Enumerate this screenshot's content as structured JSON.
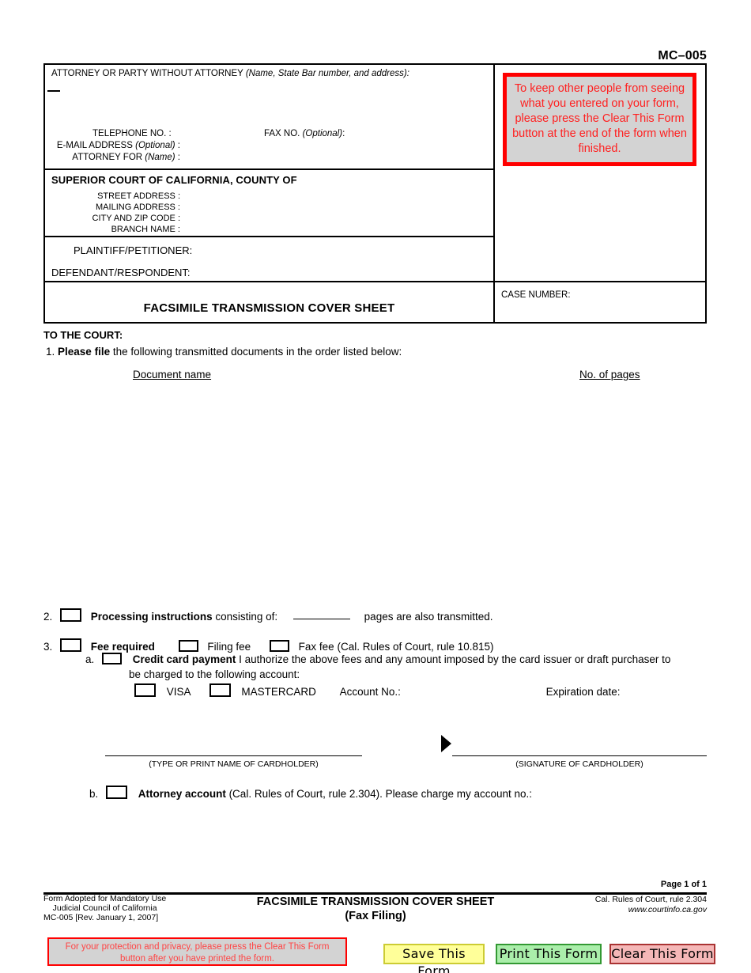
{
  "form_number": "MC–005",
  "caption": {
    "attorney_header": "ATTORNEY OR PARTY WITHOUT ATTORNEY",
    "attorney_header_italic": "(Name, State Bar number, and address):",
    "telephone_label": "TELEPHONE NO. :",
    "fax_label_plain": "FAX NO. ",
    "fax_label_italic": "(Optional)",
    "fax_label_colon": ":",
    "email_label_plain": "E-MAIL ADDRESS  ",
    "email_label_italic": "(Optional)",
    "email_label_colon": " :",
    "attorney_for_plain": "ATTORNEY FOR ",
    "attorney_for_italic": "(Name)",
    "attorney_for_colon": " :",
    "court_title": "SUPERIOR COURT OF CALIFORNIA, COUNTY OF",
    "street_address_label": "STREET ADDRESS :",
    "mailing_address_label": "MAILING ADDRESS  :",
    "city_zip_label": "CITY AND ZIP CODE :",
    "branch_name_label": "BRANCH NAME :",
    "plaintiff_label": "PLAINTIFF/PETITIONER:",
    "defendant_label": "DEFENDANT/RESPONDENT:",
    "form_title": "FACSIMILE TRANSMISSION COVER SHEET",
    "case_number_label": "CASE NUMBER:"
  },
  "notice_top": "To keep other people from seeing what you entered on your form, please press the Clear This Form button at the end of the form when finished.",
  "body": {
    "to_the_court": "TO THE COURT:",
    "item1_number": "1.",
    "item1_bold": "Please file",
    "item1_rest": " the following transmitted documents in the order listed below:",
    "col_document_name": "Document name",
    "col_no_of_pages": "No. of pages",
    "item2_number": "2.",
    "item2_bold": "Processing instructions",
    "item2_mid": " consisting of:",
    "item2_tail": "pages are also transmitted.",
    "item3_number": "3.",
    "item3_bold": "Fee required",
    "item3_filing_fee": "Filing fee",
    "item3_fax_fee": "Fax fee (Cal. Rules of Court, rule 10.815)",
    "item3a_letter": "a.",
    "item3a_bold": "Credit card payment",
    "item3a_rest": " I authorize the above fees and any amount imposed by the card issuer or draft purchaser to",
    "item3a_line2": "be charged to the following account:",
    "visa_label": "VISA",
    "mastercard_label": "MASTERCARD",
    "account_no_label": "Account No.:",
    "expiration_label": "Expiration date:",
    "cardholder_name_caption": "(TYPE OR PRINT NAME OF CARDHOLDER)",
    "cardholder_signature_caption": "(SIGNATURE OF CARDHOLDER)",
    "item3b_letter": "b.",
    "item3b_bold": "Attorney account",
    "item3b_rest": " (Cal. Rules of Court, rule 2.304). Please charge my account no.:"
  },
  "footer": {
    "page_of": "Page 1 of 1",
    "left_line1": "Form Adopted for Mandatory Use",
    "left_line2": "Judicial Council of California",
    "left_line3": "MC-005 [Rev. January 1, 2007]",
    "center_line1": "FACSIMILE TRANSMISSION COVER SHEET",
    "center_line2": "(Fax Filing)",
    "right_line1": "Cal. Rules of Court, rule 2.304",
    "right_line2": "www.courtinfo.ca.gov"
  },
  "bottom_bar": {
    "notice_line1": "For your protection and privacy, please press the Clear This Form",
    "notice_line2": "button after you have printed the form.",
    "save_label": "Save This Form",
    "print_label": "Print This Form",
    "clear_label": "Clear This Form"
  },
  "colors": {
    "notice_red": "#ff0000",
    "notice_bg": "#d3d3d3",
    "save_bg": "#ffff99",
    "print_bg": "#aaeeaa",
    "clear_bg": "#f5b7b7"
  }
}
